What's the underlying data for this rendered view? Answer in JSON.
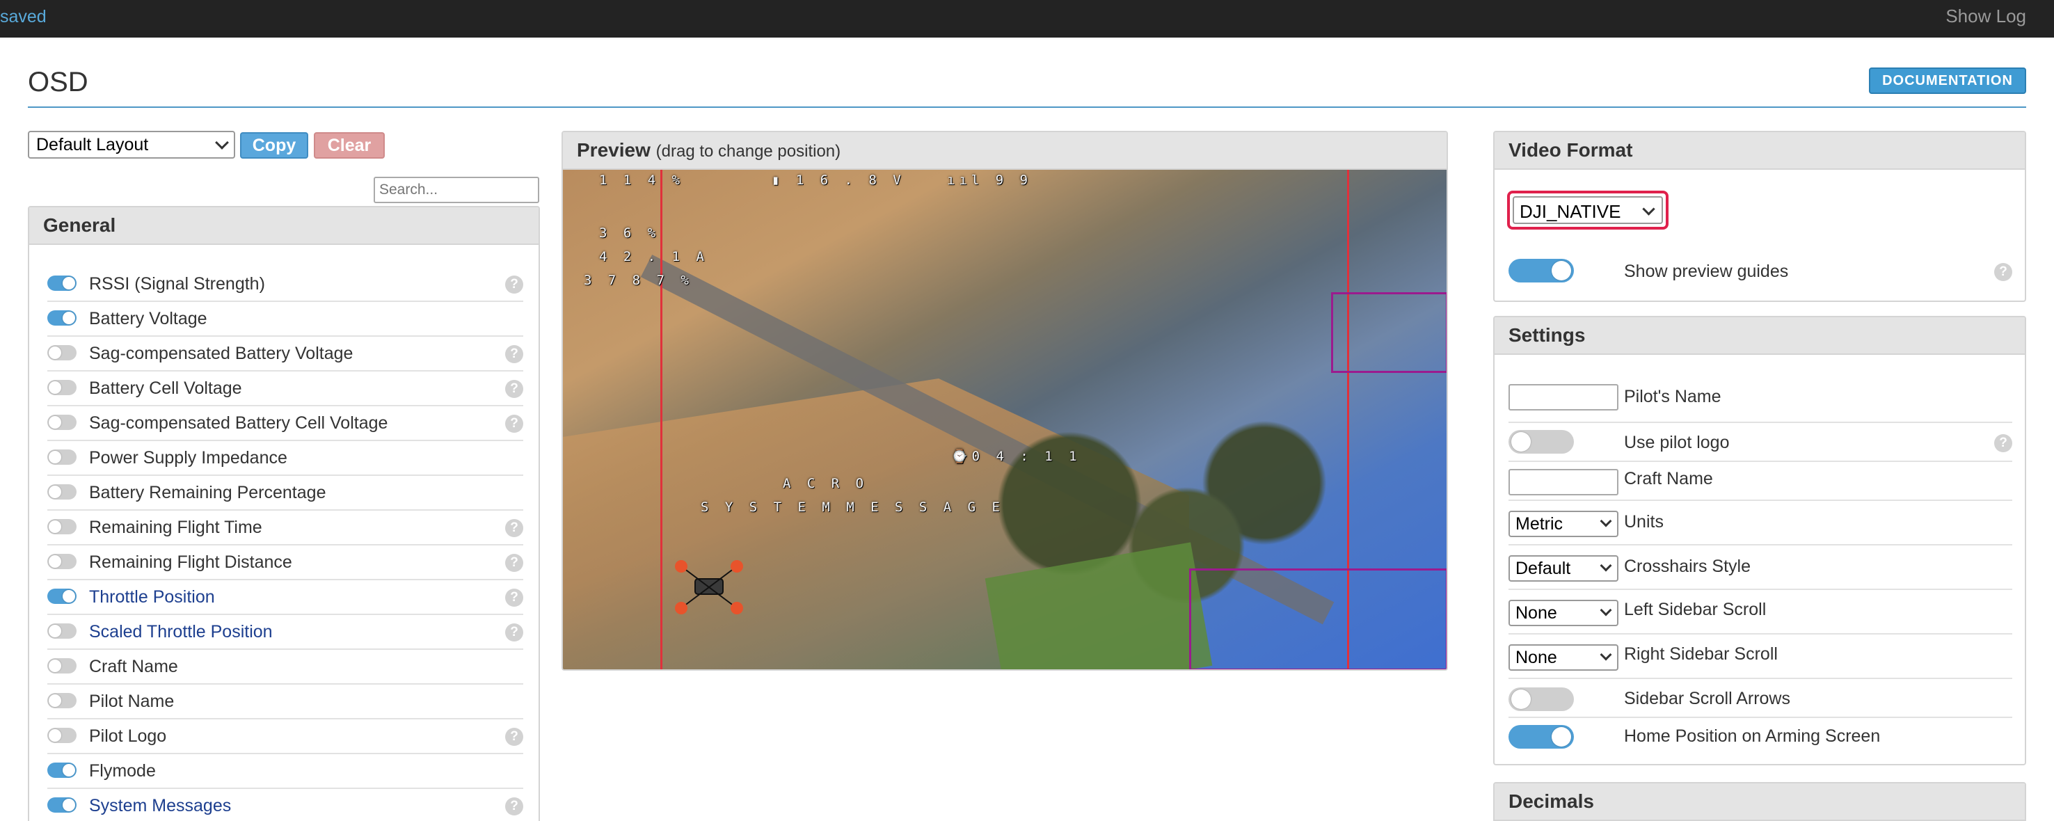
{
  "topbar": {
    "status": "saved",
    "show_log": "Show Log"
  },
  "header": {
    "title": "OSD",
    "documentation": "DOCUMENTATION"
  },
  "layout": {
    "selected": "Default Layout",
    "copy": "Copy",
    "clear": "Clear"
  },
  "search": {
    "placeholder": "Search..."
  },
  "general": {
    "title": "General",
    "items": [
      {
        "label": "RSSI (Signal Strength)",
        "on": true,
        "help": true,
        "highlight": false
      },
      {
        "label": "Battery Voltage",
        "on": true,
        "help": false,
        "highlight": false
      },
      {
        "label": "Sag-compensated Battery Voltage",
        "on": false,
        "help": true,
        "highlight": false
      },
      {
        "label": "Battery Cell Voltage",
        "on": false,
        "help": true,
        "highlight": false
      },
      {
        "label": "Sag-compensated Battery Cell Voltage",
        "on": false,
        "help": true,
        "highlight": false
      },
      {
        "label": "Power Supply Impedance",
        "on": false,
        "help": false,
        "highlight": false
      },
      {
        "label": "Battery Remaining Percentage",
        "on": false,
        "help": false,
        "highlight": false
      },
      {
        "label": "Remaining Flight Time",
        "on": false,
        "help": true,
        "highlight": false
      },
      {
        "label": "Remaining Flight Distance",
        "on": false,
        "help": true,
        "highlight": false
      },
      {
        "label": "Throttle Position",
        "on": true,
        "help": true,
        "highlight": true
      },
      {
        "label": "Scaled Throttle Position",
        "on": false,
        "help": true,
        "highlight": true
      },
      {
        "label": "Craft Name",
        "on": false,
        "help": false,
        "highlight": false
      },
      {
        "label": "Pilot Name",
        "on": false,
        "help": false,
        "highlight": false
      },
      {
        "label": "Pilot Logo",
        "on": false,
        "help": true,
        "highlight": false
      },
      {
        "label": "Flymode",
        "on": true,
        "help": false,
        "highlight": false
      },
      {
        "label": "System Messages",
        "on": true,
        "help": true,
        "highlight": true
      }
    ]
  },
  "preview": {
    "title": "Preview",
    "subtitle": "(drag to change position)",
    "osd": {
      "rssi_top": "1 1 4 %",
      "battery": "1 6 . 8 V",
      "signal": "9 9",
      "l1": "3   6 %",
      "l2": "4 2 . 1 A",
      "l3": "3 7 8 7 %",
      "timer": "0 4 : 1 1",
      "mode": "A C R O",
      "message": "S Y S T E M   M E S S A G E"
    }
  },
  "video_format": {
    "title": "Video Format",
    "selected": "DJI_NATIVE",
    "guides_label": "Show preview guides",
    "guides_on": true
  },
  "settings": {
    "title": "Settings",
    "pilot_name_label": "Pilot's Name",
    "pilot_logo_label": "Use pilot logo",
    "craft_name_label": "Craft Name",
    "units_value": "Metric",
    "units_label": "Units",
    "crosshairs_value": "Default",
    "crosshairs_label": "Crosshairs Style",
    "left_scroll_value": "None",
    "left_scroll_label": "Left Sidebar Scroll",
    "right_scroll_value": "None",
    "right_scroll_label": "Right Sidebar Scroll",
    "scroll_arrows_label": "Sidebar Scroll Arrows",
    "home_pos_label": "Home Position on Arming Screen"
  },
  "decimals": {
    "title": "Decimals"
  },
  "colors": {
    "accent": "#4f9fd6",
    "guide_red": "#e0313b",
    "guide_purple": "#9b1b8e",
    "highlight_border": "#e0214c"
  }
}
